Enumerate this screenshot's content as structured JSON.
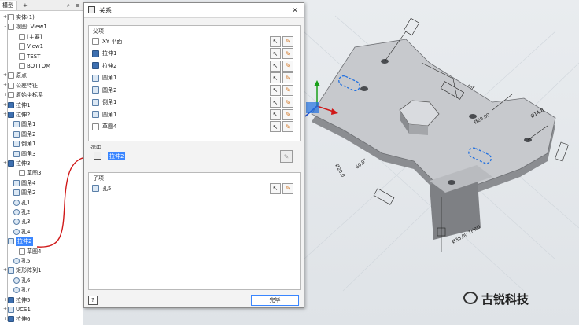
{
  "browser": {
    "tab_model": "模型",
    "tab_add": "+",
    "items": [
      {
        "label": "实体(1)",
        "exp": "+",
        "indent": 0,
        "icon": "folder"
      },
      {
        "label": "视图: View1",
        "exp": "-",
        "indent": 0,
        "icon": "view"
      },
      {
        "label": "[主要]",
        "exp": "",
        "indent": 2,
        "icon": "sketch"
      },
      {
        "label": "View1",
        "exp": "",
        "indent": 2,
        "icon": "check"
      },
      {
        "label": "TEST",
        "exp": "",
        "indent": 2,
        "icon": "sketch"
      },
      {
        "label": "BOTTOM",
        "exp": "",
        "indent": 2,
        "icon": "sketch"
      },
      {
        "label": "原点",
        "exp": "+",
        "indent": 0,
        "icon": "folder"
      },
      {
        "label": "公差特征",
        "exp": "+",
        "indent": 0,
        "icon": "folder"
      },
      {
        "label": "原始坐标系",
        "exp": "+",
        "indent": 0,
        "icon": "folder"
      },
      {
        "label": "拉伸1",
        "exp": "+",
        "indent": 0,
        "icon": "blue"
      },
      {
        "label": "拉伸2",
        "exp": "+",
        "indent": 0,
        "icon": "blue"
      },
      {
        "label": "圆角1",
        "exp": "",
        "indent": 1,
        "icon": "plain"
      },
      {
        "label": "圆角2",
        "exp": "",
        "indent": 1,
        "icon": "plain"
      },
      {
        "label": "倒角1",
        "exp": "",
        "indent": 1,
        "icon": "plain"
      },
      {
        "label": "圆角3",
        "exp": "",
        "indent": 1,
        "icon": "plain"
      },
      {
        "label": "拉伸3",
        "exp": "+",
        "indent": 0,
        "icon": "blue"
      },
      {
        "label": "草图3",
        "exp": "",
        "indent": 2,
        "icon": "sketch"
      },
      {
        "label": "圆角4",
        "exp": "",
        "indent": 1,
        "icon": "plain"
      },
      {
        "label": "圆角2",
        "exp": "",
        "indent": 1,
        "icon": "plain"
      },
      {
        "label": "孔1",
        "exp": "",
        "indent": 1,
        "icon": "circle"
      },
      {
        "label": "孔2",
        "exp": "",
        "indent": 1,
        "icon": "circle"
      },
      {
        "label": "孔3",
        "exp": "",
        "indent": 1,
        "icon": "circle"
      },
      {
        "label": "孔4",
        "exp": "",
        "indent": 1,
        "icon": "circle"
      },
      {
        "label": "拉伸2",
        "exp": "-",
        "indent": 0,
        "icon": "plain",
        "selected": true
      },
      {
        "label": "草图4",
        "exp": "",
        "indent": 2,
        "icon": "sketch"
      },
      {
        "label": "孔5",
        "exp": "",
        "indent": 1,
        "icon": "circle"
      },
      {
        "label": "矩形阵列1",
        "exp": "+",
        "indent": 0,
        "icon": "plain"
      },
      {
        "label": "孔6",
        "exp": "",
        "indent": 1,
        "icon": "circle"
      },
      {
        "label": "孔7",
        "exp": "",
        "indent": 1,
        "icon": "circle"
      },
      {
        "label": "拉伸5",
        "exp": "+",
        "indent": 0,
        "icon": "blue"
      },
      {
        "label": "UCS1",
        "exp": "+",
        "indent": 0,
        "icon": "plain"
      },
      {
        "label": "拉伸6",
        "exp": "+",
        "indent": 0,
        "icon": "blue"
      }
    ]
  },
  "dialog": {
    "title": "关系",
    "close": "×",
    "parents_label": "父项",
    "parents": [
      {
        "label": "XY 平面",
        "icon": "sketch"
      },
      {
        "label": "拉伸1",
        "icon": "blue"
      },
      {
        "label": "拉伸2",
        "icon": "blue"
      },
      {
        "label": "圆角1",
        "icon": "plain"
      },
      {
        "label": "圆角2",
        "icon": "plain"
      },
      {
        "label": "倒角1",
        "icon": "plain"
      },
      {
        "label": "圆角1",
        "icon": "plain"
      },
      {
        "label": "草图4",
        "icon": "sketch"
      }
    ],
    "selected_label": "选中",
    "selected_value": "拉伸2",
    "children_label": "子项",
    "children": [
      {
        "label": "孔5",
        "icon": "plain"
      }
    ],
    "help": "?",
    "done": "完毕",
    "select_glyph": "↖",
    "edit_glyph": "✎"
  },
  "watermark": "古锐科技",
  "colors": {
    "selection": "#3a86ff",
    "annotation": "#d01818",
    "accent_blue": "#3d6fb0"
  }
}
